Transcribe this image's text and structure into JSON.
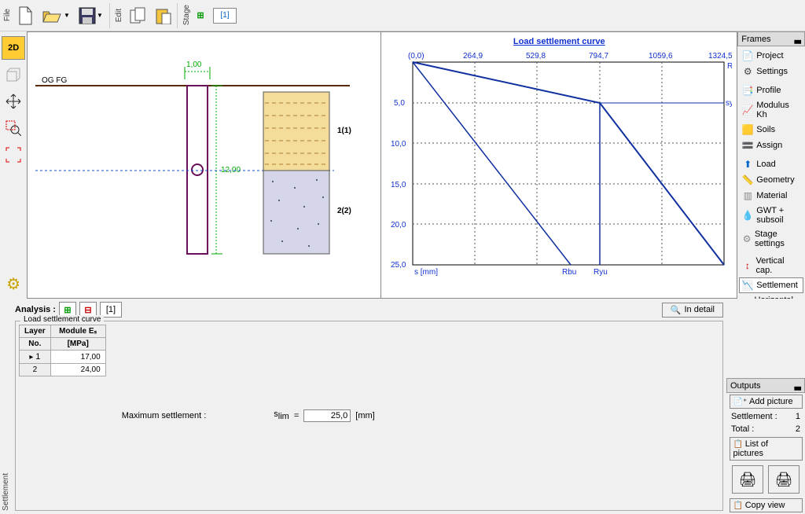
{
  "toolbar": {
    "file_label": "File",
    "edit_label": "Edit",
    "stage_label": "Stage",
    "stage_current": "[1]"
  },
  "left_tools": {
    "btn_2d": "2D",
    "btn_3d": "3D"
  },
  "sketch": {
    "og_fg": "OG FG",
    "dim_top": "1,00",
    "dim_height": "12,00",
    "layer1_label": "1(1)",
    "layer2_label": "2(2)"
  },
  "chart_data": {
    "type": "line",
    "title": "Load settlement curve",
    "xlabel": "R [kN]",
    "ylabel": "s [mm]",
    "x_ticks": [
      "(0,0)",
      "264,9",
      "529,8",
      "794,7",
      "1059,6",
      "1324,5"
    ],
    "y_ticks": [
      "5,0",
      "10,0",
      "15,0",
      "20,0",
      "25,0"
    ],
    "annotations": {
      "sy": "sy",
      "rbu": "Rbu",
      "ryu": "Ryu"
    },
    "series": [
      {
        "name": "curve",
        "points": [
          [
            0,
            0
          ],
          [
            264.9,
            1.7
          ],
          [
            529.8,
            3.3
          ],
          [
            794.7,
            5.0
          ],
          [
            1059.6,
            15.0
          ],
          [
            1324.5,
            25.0
          ]
        ]
      },
      {
        "name": "rbu_line",
        "points": [
          [
            0,
            0
          ],
          [
            672,
            25.0
          ]
        ]
      },
      {
        "name": "ryu_vert",
        "points": [
          [
            794.7,
            5.0
          ],
          [
            794.7,
            25.0
          ]
        ]
      }
    ],
    "xlim": [
      0,
      1324.5
    ],
    "ylim": [
      0,
      25
    ]
  },
  "frames": {
    "title": "Frames",
    "items": [
      "Project",
      "Settings",
      "Profile",
      "Modulus Kh",
      "Soils",
      "Assign",
      "Load",
      "Geometry",
      "Material",
      "GWT + subsoil",
      "Stage settings",
      "Vertical cap.",
      "Settlement",
      "Horizontal cap."
    ],
    "selected": "Settlement"
  },
  "analysis": {
    "label": "Analysis :",
    "stage": "[1]",
    "in_detail": "In detail",
    "group_title": "Load settlement curve",
    "table": {
      "headers": [
        "Layer No.",
        "Module E",
        "s_unit"
      ],
      "h_layer": "Layer",
      "h_no": "No.",
      "h_module": "Module Eₛ",
      "h_unit": "[MPa]",
      "rows": [
        {
          "no": "1",
          "val": "17,00"
        },
        {
          "no": "2",
          "val": "24,00"
        }
      ]
    },
    "max_label": "Maximum settlement :",
    "slim_sym": "s",
    "slim_sub": "lim",
    "slim_eq": "=",
    "slim_val": "25,0",
    "slim_unit": "[mm]"
  },
  "outputs": {
    "title": "Outputs",
    "add_picture": "Add picture",
    "settlement_label": "Settlement :",
    "settlement_val": "1",
    "total_label": "Total :",
    "total_val": "2",
    "list": "List of pictures",
    "copy": "Copy view"
  },
  "bottom_label": "Settlement"
}
